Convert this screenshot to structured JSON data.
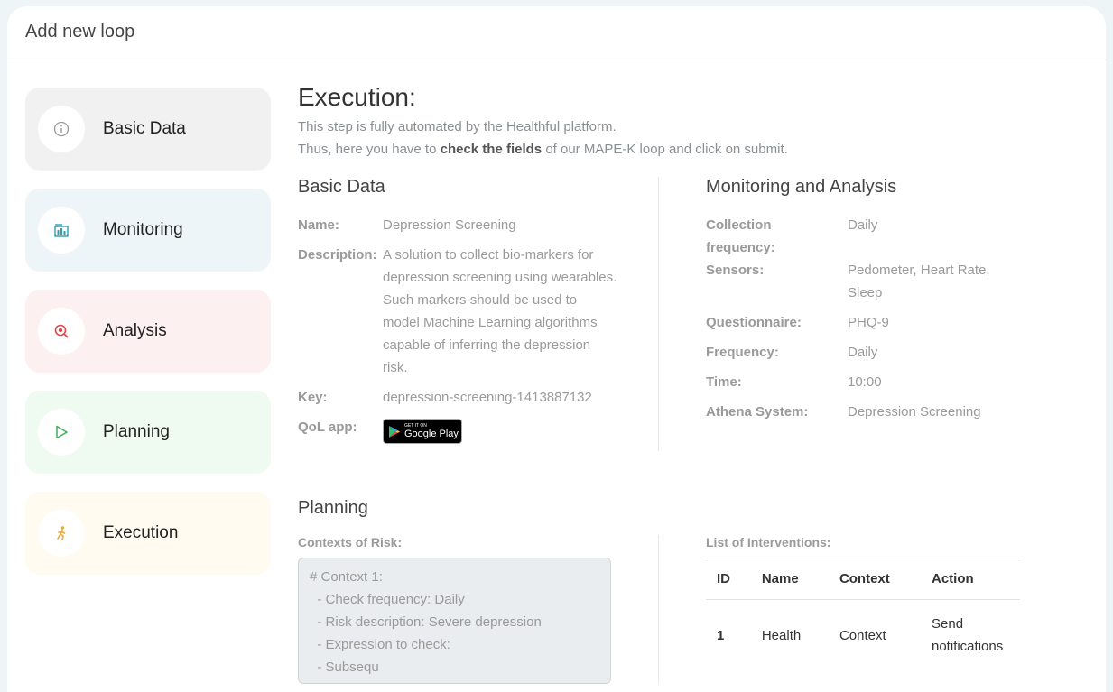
{
  "header": {
    "title": "Add new loop"
  },
  "steps": [
    {
      "label": "Basic Data",
      "bg": "#f1f1f1",
      "icon": "info-icon",
      "icon_color": "#9a9a9a"
    },
    {
      "label": "Monitoring",
      "bg": "#eef5f8",
      "icon": "building-chart-icon",
      "icon_color": "#2a9db8"
    },
    {
      "label": "Analysis",
      "bg": "#fdf0f0",
      "icon": "search-analysis-icon",
      "icon_color": "#e04848"
    },
    {
      "label": "Planning",
      "bg": "#effbf1",
      "icon": "play-icon",
      "icon_color": "#3fae5a"
    },
    {
      "label": "Execution",
      "bg": "#fffbf1",
      "icon": "running-person-icon",
      "icon_color": "#f0a83c"
    }
  ],
  "execution": {
    "title": "Execution:",
    "line1": "This step is fully automated by the Healthful platform.",
    "line2_pre": "Thus, here you have to ",
    "line2_bold": "check the fields",
    "line2_post": " of our MAPE-K loop and click on submit."
  },
  "basic_data": {
    "title": "Basic Data",
    "name_label": "Name:",
    "name_value": "Depression Screening",
    "description_label": "Description:",
    "description_value": "A solution to collect bio-markers for depression screening using wearables. Such markers should be used to model Machine Learning algorithms capable of inferring the depression risk.",
    "key_label": "Key:",
    "key_value": "depression-screening-1413887132",
    "qol_label": "QoL app:",
    "google_play": {
      "small": "GET IT ON",
      "big": "Google Play"
    }
  },
  "monitoring": {
    "title": "Monitoring and Analysis",
    "collection_label": "Collection frequency:",
    "collection_value": "Daily",
    "sensors_label": "Sensors:",
    "sensors_value": "Pedometer, Heart Rate, Sleep",
    "questionnaire_label": "Questionnaire:",
    "questionnaire_value": "PHQ-9",
    "frequency_label": "Frequency:",
    "frequency_value": "Daily",
    "time_label": "Time:",
    "time_value": "10:00",
    "athena_label": "Athena System:",
    "athena_value": "Depression Screening"
  },
  "planning": {
    "title": "Planning",
    "contexts_label": "Contexts of Risk:",
    "contexts_text": "# Context 1:\n  - Check frequency: Daily\n  - Risk description: Severe depression\n  - Expression to check:\n  - Subsequ"
  },
  "interventions": {
    "label": "List of Interventions:",
    "columns": [
      "ID",
      "Name",
      "Context",
      "Action"
    ],
    "rows": [
      {
        "id": "1",
        "name": "Health",
        "context": "Context",
        "action": "Send notifications"
      }
    ]
  }
}
